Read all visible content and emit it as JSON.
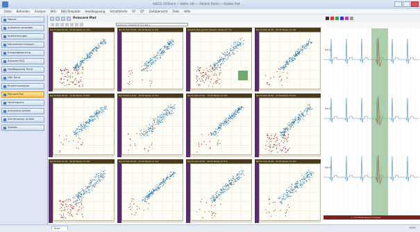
{
  "window": {
    "title": "AdECG 10 Demo — Holter 24h — Patient: Demo — Scatter Plot"
  },
  "menu": [
    "Datei",
    "Befunden",
    "Analyse",
    "EKG",
    "EKG-Template",
    "Headkopplung",
    "Schnittstelle",
    "ST",
    "QT",
    "Zeitübersicht",
    "Tools",
    "Hilfe"
  ],
  "sidebar": {
    "items": [
      {
        "label": "Patient"
      },
      {
        "label": "Aufnahme verwalten"
      },
      {
        "label": "Aufzeichnungen"
      },
      {
        "label": "Kommentare erfassen"
      },
      {
        "label": "Ereignisbewertung"
      },
      {
        "label": "Episoden EKG"
      },
      {
        "label": "Headkopplung Trend"
      },
      {
        "label": "HRV Trend"
      },
      {
        "label": "Rhythmusanalyse"
      },
      {
        "label": "Poincaré Plot"
      },
      {
        "label": "Herzfrequenz"
      },
      {
        "label": "Arrhythmie Anfälle"
      },
      {
        "label": "Schrittmacher Anfälle"
      },
      {
        "label": "Statistik"
      }
    ]
  },
  "doc_tab": {
    "label": "Poincaré Plot"
  },
  "toolbar": {
    "select_value": "Zeitraum: Gesamt (Ψ ≤ 0 Sek.)"
  },
  "panels": [
    {
      "header": "Nacht Zeit 00:00 - 03:00 Beats 12 111"
    },
    {
      "header": "Nacht Zeit 03:00 - 06:00 Beats 11 841"
    },
    {
      "header": "Gesamt Zeit gesamt Bewert. Beats 07 771"
    },
    {
      "header": "Nacht Zeit 06:00 - 09:00 Beats 13 101"
    },
    {
      "header": "Nacht Zeit 09:00 - 12:00 Beats 13 651"
    },
    {
      "header": "Nacht Zeit 12:00 - 15:00 Beats 12 911"
    },
    {
      "header": "Nacht Zeit 15:00 - 18:00 Beats 13 201"
    },
    {
      "header": "Nacht Zeit 18:00 - 21:00 Beats 14 011"
    },
    {
      "header": "Nacht Zeit 21:00 - 24:00 Beats 12 401"
    },
    {
      "header": "Nacht Zeit 00:00 - 03:00 Beats 11 711"
    },
    {
      "header": "Nacht Zeit 03:00 - 06:00 Beats 10 871"
    },
    {
      "header": "Nacht Zeit 06:00 - 09:00 Beats 12 451"
    }
  ],
  "ecg": {
    "leads": [
      {
        "label": "Kan1"
      },
      {
        "label": "Kan2"
      },
      {
        "label": "Kan3"
      }
    ],
    "time_label": "1 min Herzfrequenz Analyse"
  },
  "statusbar": {
    "tab_label": "Start",
    "right_text": "100%"
  },
  "colors": {
    "blue_points": "#2a7bb5",
    "red_points": "#a32020",
    "panel_header": "#4a3a1e",
    "axis_purple": "#5a2a6e",
    "selection_green": "#6baa6b"
  }
}
